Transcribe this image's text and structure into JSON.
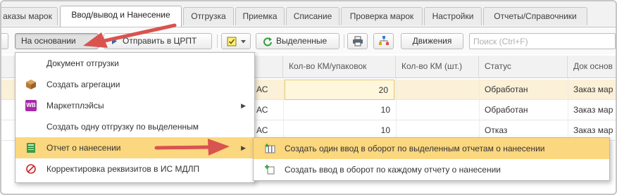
{
  "tabs": [
    {
      "label": "аказы марок"
    },
    {
      "label": "Ввод/вывод и Нанесение"
    },
    {
      "label": "Отгрузка"
    },
    {
      "label": "Приемка"
    },
    {
      "label": "Списание"
    },
    {
      "label": "Проверка марок"
    },
    {
      "label": "Настройки"
    },
    {
      "label": "Отчеты/Справочники"
    }
  ],
  "toolbar": {
    "based_on_label": "На основании",
    "send_label": "Отправить в ЦРПТ",
    "selected_label": "Выделенные",
    "movements_label": "Движения",
    "search_placeholder": "Поиск (Ctrl+F)"
  },
  "table": {
    "headers": [
      "Кол-во КМ/упаковок",
      "Кол-во КМ (шт.)",
      "Статус",
      "Док основ"
    ],
    "rows": [
      {
        "clip": "АС",
        "km_packs": "20",
        "km_pcs": "",
        "status": "Обработан",
        "doc": "Заказ мар"
      },
      {
        "clip": "АС",
        "km_packs": "10",
        "km_pcs": "",
        "status": "Обработан",
        "doc": "Заказ мар"
      },
      {
        "clip": "АС",
        "km_packs": "10",
        "km_pcs": "",
        "status": "Отказ",
        "doc": "Заказ мар"
      }
    ]
  },
  "menu": {
    "items": [
      {
        "label": "Документ отгрузки",
        "icon": "none"
      },
      {
        "label": "Создать агрегации",
        "icon": "box-icon"
      },
      {
        "label": "Маркетплэйсы",
        "icon": "wb-icon",
        "icon_text": "WB"
      },
      {
        "label": "Создать одну отгрузку по выделенным",
        "icon": "none"
      },
      {
        "label": "Отчет о нанесении",
        "icon": "report-icon"
      },
      {
        "label": "Корректировка реквизитов в ИС МДЛП",
        "icon": "no-edit-icon"
      }
    ]
  },
  "submenu": {
    "items": [
      {
        "label": "Создать один ввод в оборот по выделенным отчетам о нанесении",
        "icon": "create-multi-icon"
      },
      {
        "label": "Создать ввод в оборот по каждому отчету о нанесении",
        "icon": "create-each-icon"
      }
    ]
  },
  "colors": {
    "highlight": "#fbd77f",
    "selected_row": "#fbf0d8",
    "annotation_arrow": "#d9534f"
  }
}
